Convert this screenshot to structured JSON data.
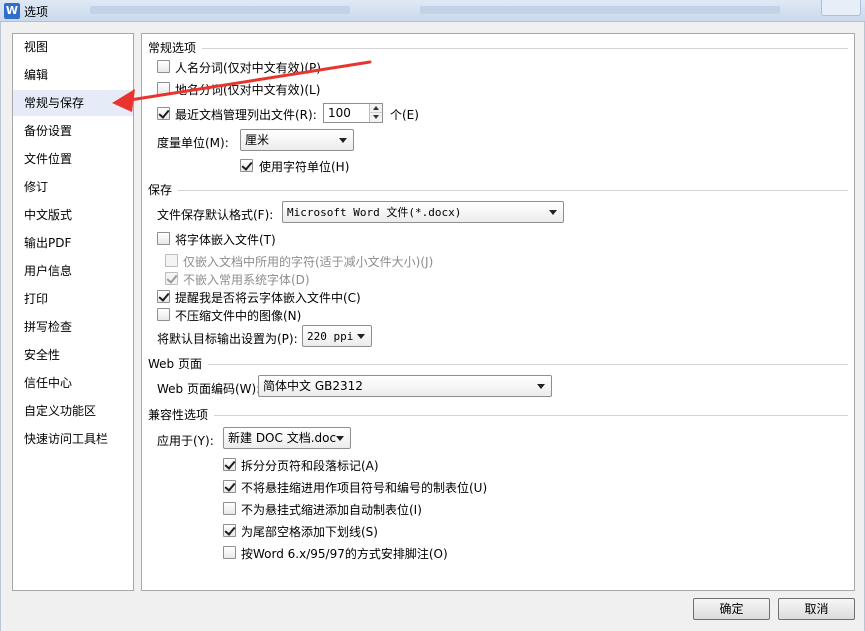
{
  "window": {
    "title": "选项",
    "app_icon_letter": "W"
  },
  "sidebar": {
    "items": [
      {
        "label": "视图"
      },
      {
        "label": "编辑"
      },
      {
        "label": "常规与保存"
      },
      {
        "label": "备份设置"
      },
      {
        "label": "文件位置"
      },
      {
        "label": "修订"
      },
      {
        "label": "中文版式"
      },
      {
        "label": "输出PDF"
      },
      {
        "label": "用户信息"
      },
      {
        "label": "打印"
      },
      {
        "label": "拼写检查"
      },
      {
        "label": "安全性"
      },
      {
        "label": "信任中心"
      },
      {
        "label": "自定义功能区"
      },
      {
        "label": "快速访问工具栏"
      }
    ],
    "selected": "常规与保存"
  },
  "general": {
    "title": "常规选项",
    "name_segmentation": {
      "label": "人名分词(仅对中文有效)(P)",
      "checked": false
    },
    "place_segmentation": {
      "label": "地名分词(仅对中文有效)(L)",
      "checked": false
    },
    "recent_docs": {
      "label": "最近文档管理列出文件(R):",
      "checked": true,
      "value": "100",
      "unit": "个(E)"
    },
    "measure_unit": {
      "label": "度量单位(M):",
      "value": "厘米"
    },
    "char_unit": {
      "label": "使用字符单位(H)",
      "checked": true
    }
  },
  "save": {
    "title": "保存",
    "default_format": {
      "label": "文件保存默认格式(F):",
      "value": "Microsoft Word 文件(*.docx)"
    },
    "embed_fonts": {
      "label": "将字体嵌入文件(T)",
      "checked": false
    },
    "embed_used_chars": {
      "label": "仅嵌入文档中所用的字符(适于减小文件大小)(J)",
      "checked": false
    },
    "no_embed_system": {
      "label": "不嵌入常用系统字体(D)",
      "checked": true
    },
    "remind_cloud_fonts": {
      "label": "提醒我是否将云字体嵌入文件中(C)",
      "checked": true
    },
    "no_compress_images": {
      "label": "不压缩文件中的图像(N)",
      "checked": false
    },
    "output_resolution": {
      "label": "将默认目标输出设置为(P):",
      "value": "220 ppi"
    }
  },
  "web": {
    "title": "Web 页面",
    "encoding": {
      "label": "Web 页面编码(W):",
      "value": "简体中文 GB2312"
    }
  },
  "compat": {
    "title": "兼容性选项",
    "apply_to": {
      "label": "应用于(Y):",
      "value": "新建 DOC 文档.doc"
    },
    "options": [
      {
        "label": "拆分分页符和段落标记(A)",
        "checked": true
      },
      {
        "label": "不将悬挂缩进用作项目符号和编号的制表位(U)",
        "checked": true
      },
      {
        "label": "不为悬挂式缩进添加自动制表位(I)",
        "checked": false
      },
      {
        "label": "为尾部空格添加下划线(S)",
        "checked": true
      },
      {
        "label": "按Word 6.x/95/97的方式安排脚注(O)",
        "checked": false
      }
    ]
  },
  "footer": {
    "ok_label": "确定",
    "cancel_label": "取消"
  },
  "colors": {
    "annotation_arrow": "#e8342d",
    "selection": "#e5ecf8"
  }
}
